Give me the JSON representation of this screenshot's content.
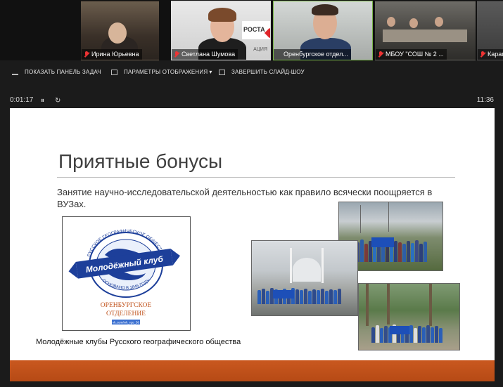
{
  "participants": [
    {
      "name": "Ирина Юрьевна",
      "muted": true
    },
    {
      "name": "Светлана Шумова",
      "muted": true
    },
    {
      "name": "Оренбургское отдел...",
      "muted": false,
      "active": true
    },
    {
      "name": "МБОУ \"СОШ № 2 ...",
      "muted": true
    },
    {
      "name": "Карап",
      "muted": true
    }
  ],
  "tile_texts": {
    "rosta": "РОСТА",
    "bannerfoot": "АЦИЯ"
  },
  "toolbar": {
    "show_taskbar": "ПОКАЗАТЬ ПАНЕЛЬ ЗАДАЧ",
    "display_settings": "ПАРАМЕТРЫ ОТОБРАЖЕНИЯ",
    "display_settings_caret": "▾",
    "end_slideshow": "ЗАВЕРШИТЬ СЛАЙД-ШОУ"
  },
  "player": {
    "elapsed": "0:01:17",
    "pause": "⏸",
    "restart": "↻",
    "clock": "11:36"
  },
  "slide": {
    "title": "Приятные бонусы",
    "text": "Занятие научно-исследовательской деятельностью как правило всячески поощряется в ВУЗах.",
    "caption": "Молодёжные клубы Русского географического общества",
    "logo": {
      "ring_top": "РУССКОЕ ГЕОГРАФИЧЕСКОЕ ОБЩЕСТВО",
      "ring_bottom": "ОСНОВАНО В 1845 ГОДУ",
      "banner": "Молодёжный клуб",
      "org_line1": "ОРЕНБУРГСКОЕ",
      "org_line2": "ОТДЕЛЕНИЕ",
      "link": "vk.com/mk_rgo_56"
    }
  },
  "colors": {
    "accent_bar": "#c0521b",
    "active_border": "#7ab648",
    "logo_blue": "#1d3f9a",
    "mic_muted": "#e33"
  }
}
